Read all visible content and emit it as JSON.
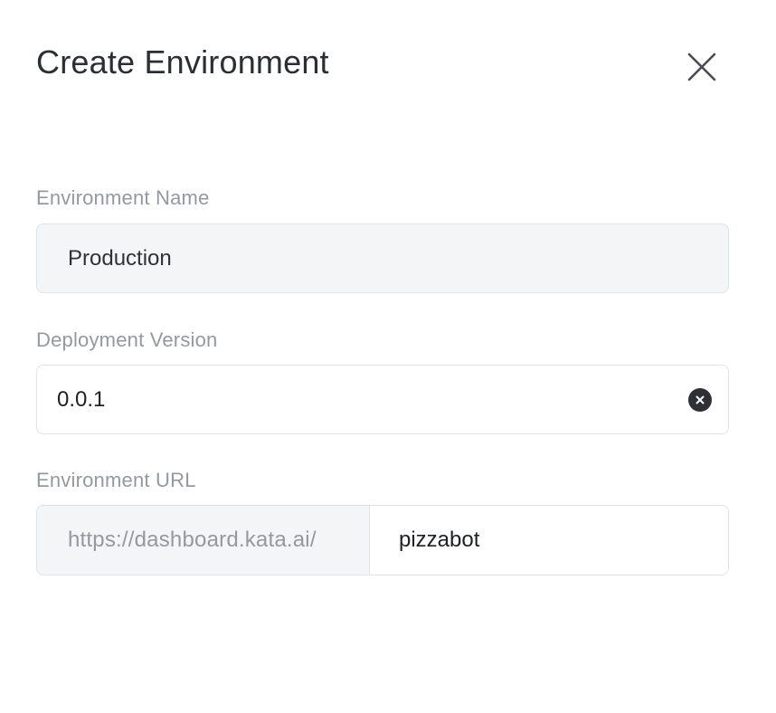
{
  "modal": {
    "title": "Create Environment",
    "close_icon": "close-icon"
  },
  "fields": {
    "environment_name": {
      "label": "Environment Name",
      "value": "Production"
    },
    "deployment_version": {
      "label": "Deployment Version",
      "value": "0.0.1",
      "clear_icon": "clear-circle-icon"
    },
    "environment_url": {
      "label": "Environment URL",
      "prefix": "https://dashboard.kata.ai/",
      "value": "pizzabot"
    }
  },
  "colors": {
    "title": "#2b2e33",
    "label": "#9499a0",
    "input_bg_disabled": "#f4f5f7",
    "border": "#dfe2e6",
    "clear_button": "#2e3033"
  }
}
